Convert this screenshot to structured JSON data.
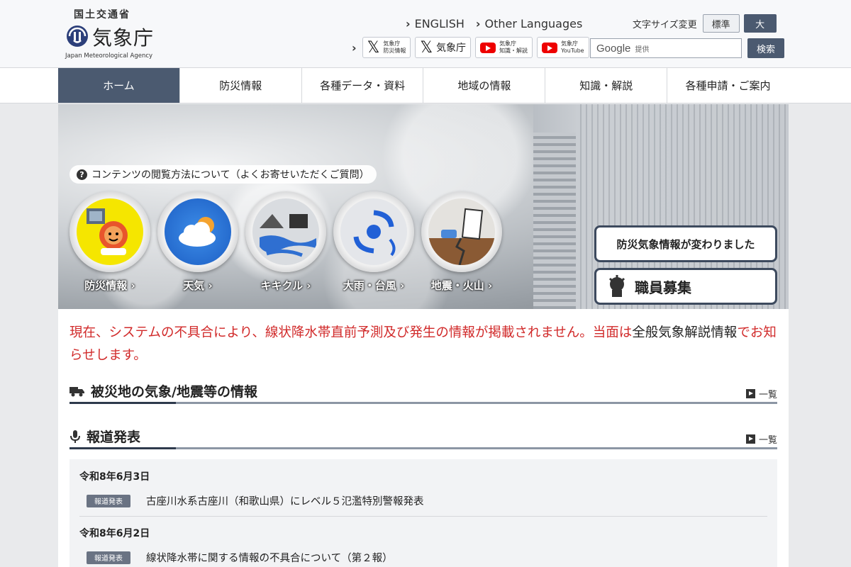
{
  "header": {
    "ministry": "国土交通省",
    "agency": "気象庁",
    "agency_en": "Japan Meteorological Agency",
    "lang_links": [
      "ENGLISH",
      "Other Languages"
    ],
    "fontsize_label": "文字サイズ変更",
    "fontsize_options": [
      "標準",
      "大"
    ],
    "social": {
      "x1": "気象庁\n防災情報",
      "x2": "気象庁",
      "yt1": "気象庁\n知識・解説",
      "yt2": "気象庁\nYouTube"
    },
    "search_brand": "Google",
    "search_provided": "提供",
    "search_button": "検索"
  },
  "nav": [
    "ホーム",
    "防災情報",
    "各種データ・資料",
    "地域の情報",
    "知識・解説",
    "各種申請・ご案内"
  ],
  "hero": {
    "faq": "コンテンツの閲覧方法について（よくお寄せいただくご質問）",
    "circles": [
      "防災情報",
      "天気",
      "キキクル",
      "大雨・台風",
      "地震・火山"
    ],
    "btn_notice": "防災気象情報が変わりました",
    "btn_recruit": "職員募集"
  },
  "notice": {
    "text_red": "現在、システムの不具合により、線状降水帯直前予測及び発生の情報が掲載されません。当面は",
    "link": "全般気象解説情報",
    "text_end": "でお知らせします。"
  },
  "sections": {
    "disaster_title": "被災地の気象/地震等の情報",
    "press_title": "報道発表",
    "more": "一覧"
  },
  "press": [
    {
      "date": "令和8年6月3日",
      "tag": "報道発表",
      "title": "古座川水系古座川（和歌山県）にレベル５氾濫特別警報発表"
    },
    {
      "date": "令和8年6月2日",
      "tag": "報道発表",
      "title": "線状降水帯に関する情報の不具合について（第２報）"
    }
  ],
  "colors": {
    "accent": "#4b5a70",
    "notice_red": "#d12a2a"
  }
}
